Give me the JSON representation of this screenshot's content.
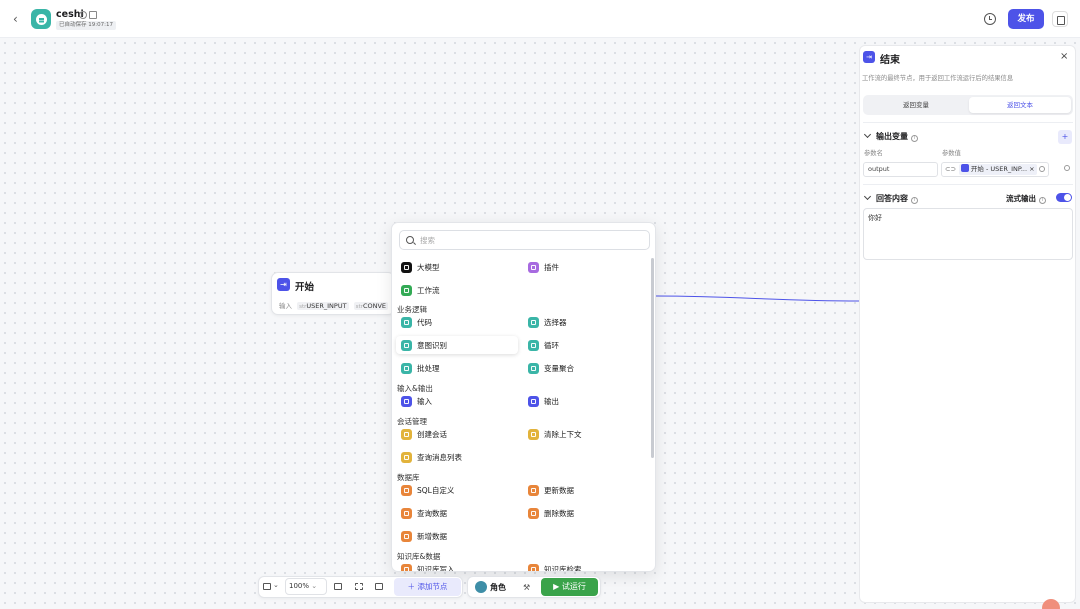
{
  "app": {
    "name": "ceshi",
    "autosave": "已自动保存 19:07:17",
    "publish_label": "发布"
  },
  "start_node": {
    "title": "开始",
    "input_label": "输入",
    "params": [
      {
        "type": "str",
        "name": "USER_INPUT"
      },
      {
        "type": "str",
        "name": "CONVE"
      }
    ]
  },
  "panel": {
    "title": "结束",
    "description": "工作流的最终节点，用于返回工作流运行后的结果信息",
    "tabs": [
      "返回变量",
      "返回文本"
    ],
    "active_tab": "返回文本",
    "output_section": {
      "title": "输出变量",
      "add": "+",
      "col_name": "参数名",
      "col_value": "参数值",
      "row": {
        "name": "output",
        "value_type": "⊂⊃",
        "ref": "开始 - USER_INP...",
        "clear": "×"
      }
    },
    "answer_section": {
      "title": "回答内容",
      "stream_label": "流式输出",
      "stream_on": true,
      "content": "你好"
    },
    "close": "×"
  },
  "menu": {
    "search_placeholder": "搜索",
    "top": [
      {
        "label": "大模型",
        "color": "#111111"
      },
      {
        "label": "插件",
        "color": "#a76ae0"
      },
      {
        "label": "工作流",
        "color": "#33aa55"
      }
    ],
    "groups": [
      {
        "title": "业务逻辑",
        "items": [
          {
            "label": "代码",
            "color": "#3ab5a7"
          },
          {
            "label": "选择器",
            "color": "#3ab5a7"
          },
          {
            "label": "意图识别",
            "color": "#3ab5a7"
          },
          {
            "label": "循环",
            "color": "#3ab5a7"
          },
          {
            "label": "批处理",
            "color": "#3ab5a7"
          },
          {
            "label": "变量聚合",
            "color": "#3ab5a7"
          }
        ]
      },
      {
        "title": "输入&输出",
        "items": [
          {
            "label": "输入",
            "color": "#4d53e8"
          },
          {
            "label": "输出",
            "color": "#4d53e8"
          }
        ]
      },
      {
        "title": "会话管理",
        "items": [
          {
            "label": "创建会话",
            "color": "#e2b33b"
          },
          {
            "label": "清除上下文",
            "color": "#e2b33b"
          },
          {
            "label": "查询消息列表",
            "color": "#e2b33b"
          }
        ]
      },
      {
        "title": "数据库",
        "items": [
          {
            "label": "SQL自定义",
            "color": "#e8853a"
          },
          {
            "label": "更新数据",
            "color": "#e8853a"
          },
          {
            "label": "查询数据",
            "color": "#e8853a"
          },
          {
            "label": "删除数据",
            "color": "#e8853a"
          },
          {
            "label": "新增数据",
            "color": "#e8853a"
          }
        ]
      },
      {
        "title": "知识库&数据",
        "items": [
          {
            "label": "知识库写入",
            "color": "#e8853a"
          },
          {
            "label": "知识库检索",
            "color": "#e8853a"
          }
        ]
      }
    ]
  },
  "toolbar": {
    "zoom": "100%",
    "add_node": "添加节点",
    "role": "角色",
    "run": "试运行"
  }
}
